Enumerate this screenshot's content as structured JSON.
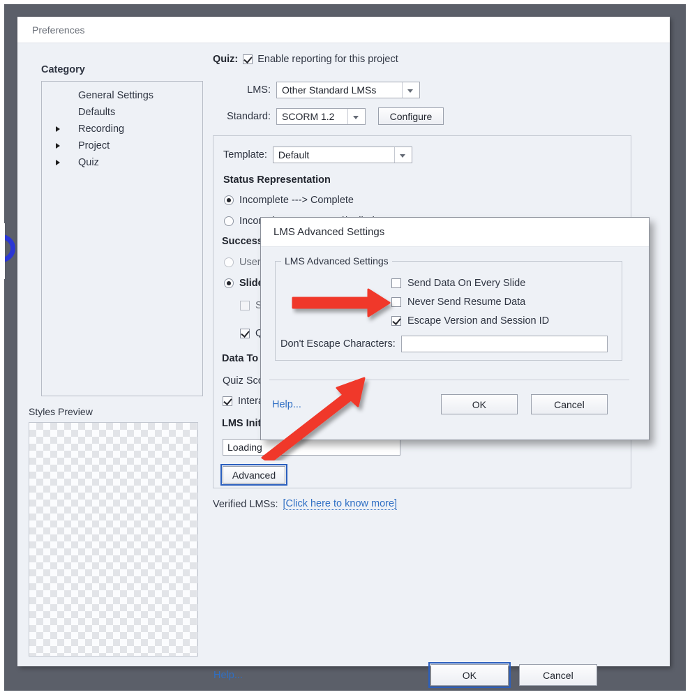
{
  "window": {
    "title": "Preferences"
  },
  "sidebar": {
    "heading": "Category",
    "items": [
      {
        "label": "General Settings",
        "expandable": false
      },
      {
        "label": "Defaults",
        "expandable": false
      },
      {
        "label": "Recording",
        "expandable": true
      },
      {
        "label": "Project",
        "expandable": true
      },
      {
        "label": "Quiz",
        "expandable": true
      }
    ],
    "styles_preview_label": "Styles Preview"
  },
  "quiz": {
    "quiz_label": "Quiz:",
    "enable_reporting_label": "Enable reporting for this project",
    "enable_reporting_checked": true,
    "lms_label": "LMS:",
    "lms_value": "Other Standard LMSs",
    "standard_label": "Standard:",
    "standard_value": "SCORM 1.2",
    "configure_label": "Configure",
    "template_label": "Template:",
    "template_value": "Default",
    "status_representation_heading": "Status Representation",
    "status_options": [
      {
        "label": "Incomplete ---> Complete",
        "selected": true
      },
      {
        "label": "Incomplete ---> Passed/Failed",
        "selected": false
      }
    ],
    "success_criteria_heading": "Success/Co",
    "success_options": [
      {
        "label": "User Acce",
        "selected": false
      },
      {
        "label": "Slide view",
        "selected": true
      }
    ],
    "slide_sub_label": "Slide ",
    "slide_sub_checked": false,
    "quiz_sub_label": "Quiz",
    "quiz_sub_checked": true,
    "data_to_report_heading": "Data To Re",
    "quiz_score_label": "Quiz Score",
    "interactions_label": "Interactio",
    "interactions_checked": true,
    "lms_initialization_heading": "LMS Initiali",
    "loading_value": "Loading",
    "advanced_label": "Advanced",
    "verified_lms_label": "Verified LMSs:",
    "verified_lms_link": "[Click here to know more]"
  },
  "footer": {
    "help_label": "Help...",
    "ok_label": "OK",
    "cancel_label": "Cancel"
  },
  "dialog": {
    "title": "LMS Advanced Settings",
    "group_legend": "LMS Advanced Settings",
    "checkboxes": [
      {
        "label": "Send Data On Every Slide",
        "checked": false
      },
      {
        "label": "Never Send Resume Data",
        "checked": false
      },
      {
        "label": "Escape Version and Session ID",
        "checked": true
      }
    ],
    "dont_escape_label": "Don't Escape Characters:",
    "dont_escape_value": "",
    "help_label": "Help...",
    "ok_label": "OK",
    "cancel_label": "Cancel"
  },
  "annotations": {
    "arrow_color": "#f0392c",
    "arrow_1_target": "Never Send Resume Data",
    "arrow_2_target": "Advanced"
  },
  "colors": {
    "window_bg": "#eef1f6",
    "titlebar_bg": "#ffffff",
    "frame": "#5b5f69",
    "link": "#2f6fc4",
    "accent_focus": "#2b5fbe"
  }
}
